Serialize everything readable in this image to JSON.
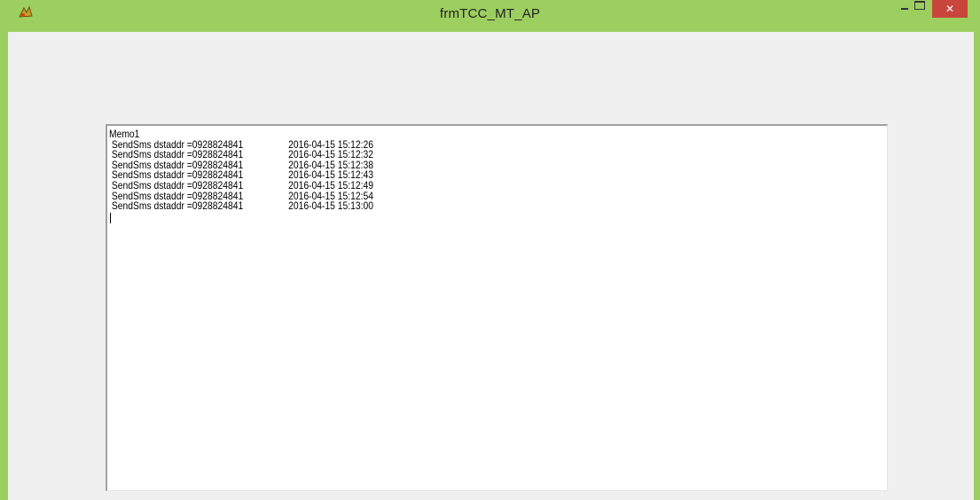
{
  "window": {
    "title": "frmTCC_MT_AP",
    "app_icon": "app-logo-icon",
    "controls": {
      "minimize": "minimize-icon",
      "maximize": "maximize-icon",
      "close_label": "✕"
    },
    "colors": {
      "frame": "#9ccf5f",
      "client": "#f0f0f0",
      "close": "#c9463d"
    }
  },
  "memo": {
    "header": "Memo1",
    "lines": [
      {
        "message": " SendSms dstaddr =0928824841",
        "time": "2016-04-15 15:12:26"
      },
      {
        "message": " SendSms dstaddr =0928824841",
        "time": "2016-04-15 15:12:32"
      },
      {
        "message": " SendSms dstaddr =0928824841",
        "time": "2016-04-15 15:12:38"
      },
      {
        "message": " SendSms dstaddr =0928824841",
        "time": "2016-04-15 15:12:43"
      },
      {
        "message": " SendSms dstaddr =0928824841",
        "time": "2016-04-15 15:12:49"
      },
      {
        "message": " SendSms dstaddr =0928824841",
        "time": "2016-04-15 15:12:54"
      },
      {
        "message": " SendSms dstaddr =0928824841",
        "time": "2016-04-15 15:13:00"
      }
    ]
  }
}
